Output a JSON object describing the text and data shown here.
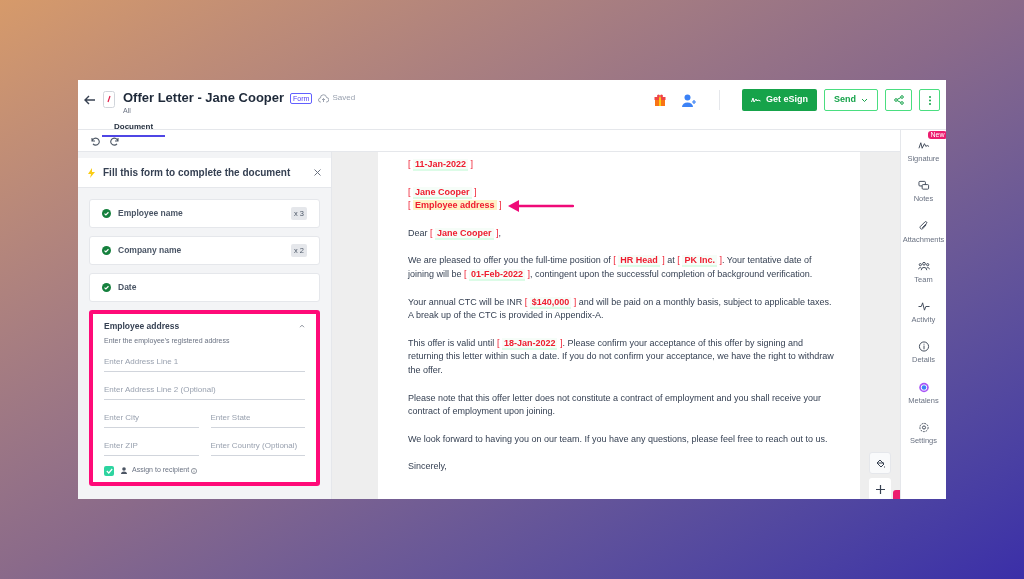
{
  "header": {
    "title": "Offer Letter - Jane Cooper",
    "badge": "Form",
    "save_status": "Saved",
    "subtitle": "All",
    "tabs": [
      {
        "label": "Document",
        "selected": true
      }
    ],
    "buttons": [
      {
        "kind": "primary",
        "label": "Get eSign"
      },
      {
        "kind": "dropdown",
        "label": "Send"
      }
    ]
  },
  "form_panel": {
    "title": "Fill this form to complete the document",
    "items": [
      {
        "title": "Employee name",
        "completed": true,
        "count": "x 3",
        "expanded": false,
        "highlighted": false
      },
      {
        "title": "Company name",
        "completed": true,
        "count": "x 2",
        "expanded": false,
        "highlighted": false
      },
      {
        "title": "Date",
        "completed": true,
        "expanded": false,
        "highlighted": false
      },
      {
        "title": "Employee address",
        "expanded": true,
        "highlighted": true,
        "description": "Enter the employee's registered address",
        "fields": [
          [
            {
              "placeholder": "Enter Address Line 1"
            }
          ],
          [
            {
              "placeholder": "Enter Address Line 2 (Optional)"
            }
          ],
          [
            {
              "placeholder": "Enter City"
            },
            {
              "placeholder": "Enter State"
            }
          ],
          [
            {
              "placeholder": "Enter ZIP"
            },
            {
              "placeholder": "Enter Country (Optional)"
            }
          ]
        ],
        "assign": {
          "label": "Assign to recipient",
          "checked": true
        }
      }
    ]
  },
  "letter": {
    "paragraphs": [
      [
        {
          "kind": "field",
          "open": "[",
          "value": "11-Jan-2022",
          "close": "]",
          "filled": true
        }
      ],
      [
        {
          "kind": "field",
          "open": "[",
          "value": "Jane Cooper",
          "close": "]",
          "filled": true
        },
        {
          "kind": "break"
        },
        {
          "kind": "field",
          "open": "[",
          "value": "Employee address",
          "close": "]",
          "filled": false,
          "arrow": true
        }
      ],
      [
        {
          "kind": "text",
          "text": "Dear "
        },
        {
          "kind": "field",
          "open": "[",
          "value": "Jane Cooper",
          "close": "]",
          "filled": true
        },
        {
          "kind": "text",
          "text": ","
        }
      ],
      [
        {
          "kind": "text",
          "text": "We are pleased to offer you the full-time position of "
        },
        {
          "kind": "field",
          "open": "[",
          "value": "HR Head",
          "close": "]",
          "filled": true
        },
        {
          "kind": "text",
          "text": " at "
        },
        {
          "kind": "field",
          "open": "[",
          "value": "PK Inc.",
          "close": "]",
          "filled": true
        },
        {
          "kind": "text",
          "text": ". Your tentative date of joining will be "
        },
        {
          "kind": "field",
          "open": "[",
          "value": "01-Feb-2022",
          "close": "]",
          "filled": true
        },
        {
          "kind": "text",
          "text": ", contingent upon the successful completion of background verification."
        }
      ],
      [
        {
          "kind": "text",
          "text": "Your annual CTC will be INR "
        },
        {
          "kind": "field",
          "open": "[",
          "value": "$140,000",
          "close": "]",
          "filled": true
        },
        {
          "kind": "text",
          "text": " and will be paid on a monthly basis, subject to applicable taxes. A break up of the CTC is provided in Appendix-A."
        }
      ],
      [
        {
          "kind": "text",
          "text": "This offer is valid until "
        },
        {
          "kind": "field",
          "open": "[",
          "value": "18-Jan-2022",
          "close": "]",
          "filled": true
        },
        {
          "kind": "text",
          "text": ". Please confirm your acceptance of this offer by signing and returning this letter within such a date. If you do not confirm your acceptance, we have the right to withdraw the offer."
        }
      ],
      [
        {
          "kind": "text",
          "text": "Please note that this offer letter does not constitute a contract of employment and you shall receive your contract of employment upon joining."
        }
      ],
      [
        {
          "kind": "text",
          "text": "We look forward to having you on our team. If you have any questions, please feel free to reach out to us."
        }
      ],
      [
        {
          "kind": "text",
          "text": "Sincerely,"
        }
      ]
    ]
  },
  "sidebar": {
    "items": [
      {
        "kind": "signature",
        "label": "Signature",
        "badge": "New"
      },
      {
        "kind": "notes",
        "label": "Notes"
      },
      {
        "kind": "attachment",
        "label": "Attachments"
      },
      {
        "kind": "team",
        "label": "Team"
      },
      {
        "kind": "activity",
        "label": "Activity"
      },
      {
        "kind": "details",
        "label": "Details"
      },
      {
        "kind": "metalens",
        "label": "Metalens"
      },
      {
        "kind": "settings",
        "label": "Settings"
      }
    ]
  }
}
